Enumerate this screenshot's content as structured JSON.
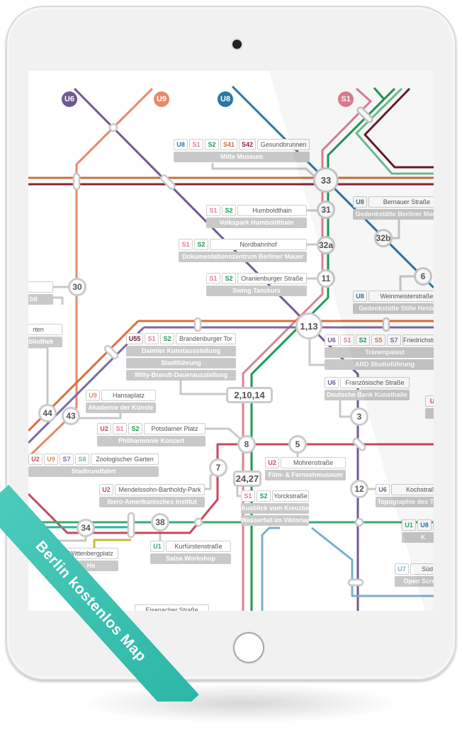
{
  "ribbon": {
    "text": "Berlin kostenlos Map",
    "color": "#3cc0b0"
  },
  "line_colors": {
    "U1": "#3aa872",
    "U2": "#c8475f",
    "U6": "#6f5a8f",
    "U7": "#7ab0cc",
    "U8": "#2a77a3",
    "U9": "#e8896a",
    "U55": "#6b1a2a",
    "S1": "#e07f94",
    "S2": "#1c9a55",
    "S5": "#e0743c",
    "S7": "#7b6aa0",
    "S8": "#6fc093",
    "S41": "#c8703e",
    "S42": "#8e1f3b",
    "U": "#c8475f"
  },
  "line_flags": [
    {
      "label": "U6",
      "color": "#6f5a8f"
    },
    {
      "label": "U9",
      "color": "#e8896a"
    },
    {
      "label": "U8",
      "color": "#2a77a3"
    },
    {
      "label": "S1",
      "color": "#e07f94"
    }
  ],
  "stations": [
    {
      "label": "33"
    },
    {
      "label": "31"
    },
    {
      "label": "32a"
    },
    {
      "label": "11"
    },
    {
      "label": "32b"
    },
    {
      "label": "6"
    },
    {
      "label": "30"
    },
    {
      "label": "1,13"
    },
    {
      "label": "2,10,14"
    },
    {
      "label": "44"
    },
    {
      "label": "43"
    },
    {
      "label": "8"
    },
    {
      "label": "5"
    },
    {
      "label": "3"
    },
    {
      "label": "7"
    },
    {
      "label": "24,27"
    },
    {
      "label": "12"
    },
    {
      "label": "34"
    },
    {
      "label": "38"
    }
  ],
  "labels": [
    {
      "lines": [
        "U8",
        "S1",
        "S2",
        "S41",
        "S42"
      ],
      "name": "Gesundbrunnen",
      "subs": [
        "Mitte Museum"
      ]
    },
    {
      "lines": [
        "S1",
        "S2"
      ],
      "name": "Humboldthain",
      "subs": [
        "Volkspark Humboldthain"
      ]
    },
    {
      "lines": [
        "S1",
        "S2"
      ],
      "name": "Nordbahnhof",
      "subs": [
        "Dokumentationszentrum Berliner Mauer"
      ]
    },
    {
      "lines": [
        "S1",
        "S2"
      ],
      "name": "Oranienburger Straße",
      "subs": [
        "Swing Tanzkurs"
      ]
    },
    {
      "lines": [
        "U8"
      ],
      "name": "Bernauer Straße",
      "subs": [
        "Gedenkstätte Berliner Mauer"
      ]
    },
    {
      "lines": [
        "U8"
      ],
      "name": "Weinmeisterstraße",
      "subs": [
        "Gedenkstätte Stille Helden"
      ]
    },
    {
      "lines": [
        "U55",
        "S1",
        "S2"
      ],
      "name": "Brandenburger Tor",
      "subs": [
        "Daimler Kunstausstellung",
        "Stadtführung",
        "Willy-Brandt-Dauerausstellung"
      ]
    },
    {
      "lines": [
        "U6",
        "S1",
        "S2",
        "S5",
        "S7"
      ],
      "name": "Friedrichstraße",
      "subs": [
        "Tränenpalast",
        "ARD Studioführung"
      ]
    },
    {
      "lines": [
        "U6"
      ],
      "name": "Französische Straße",
      "subs": [
        "Deutsche Bank Kunsthalle"
      ]
    },
    {
      "lines": [
        "U9"
      ],
      "name": "Hansaplatz",
      "subs": [
        "Akademie der Künste"
      ]
    },
    {
      "lines": [
        "U2",
        "S1",
        "S2"
      ],
      "name": "Potsdamer Platz",
      "subs": [
        "Philharmonie Konzert"
      ]
    },
    {
      "lines": [
        "U2"
      ],
      "name": "Mohrenstraße",
      "subs": [
        "Film- & Fernsehmuseum"
      ]
    },
    {
      "lines": [
        "U2",
        "U9",
        "S7",
        "S8"
      ],
      "name": "Zoologischer Garten",
      "subs": [
        "Stadtrundfahrt"
      ]
    },
    {
      "lines": [
        "U2"
      ],
      "name": "Mendelssohn-Bartholdy-Park",
      "subs": [
        "Ibero-Amerikanisches Institut"
      ]
    },
    {
      "lines": [
        "S1",
        "S2"
      ],
      "name": "Yorckstraße",
      "subs": [
        "Ausblick vom Kreuzberg",
        "Wasserfall im Viktoriapark"
      ]
    },
    {
      "lines": [
        "U6"
      ],
      "name": "Kochstraße",
      "subs": [
        "Topographie des Terrors"
      ]
    },
    {
      "lines": [
        "U1",
        "U8"
      ],
      "name": "",
      "subs": [
        "K"
      ]
    },
    {
      "lines": [
        "U7"
      ],
      "name": "Süd",
      "subs": [
        "Open Scre"
      ]
    },
    {
      "lines": [
        "U1"
      ],
      "name": "Kurfürstenstraße",
      "subs": [
        "Salsa Workshop"
      ]
    },
    {
      "lines": [],
      "name": "Wittenbergplatz",
      "subs": [
        "Ha"
      ]
    },
    {
      "lines": [],
      "name": "",
      "subs": [
        "bit"
      ]
    },
    {
      "lines": [],
      "name": "rten",
      "subs": [
        "bibliothek"
      ]
    },
    {
      "lines": [],
      "name": "Eisenacher Straße",
      "subs": []
    },
    {
      "lines": [
        "U"
      ],
      "name": "",
      "subs": [
        ""
      ]
    }
  ]
}
